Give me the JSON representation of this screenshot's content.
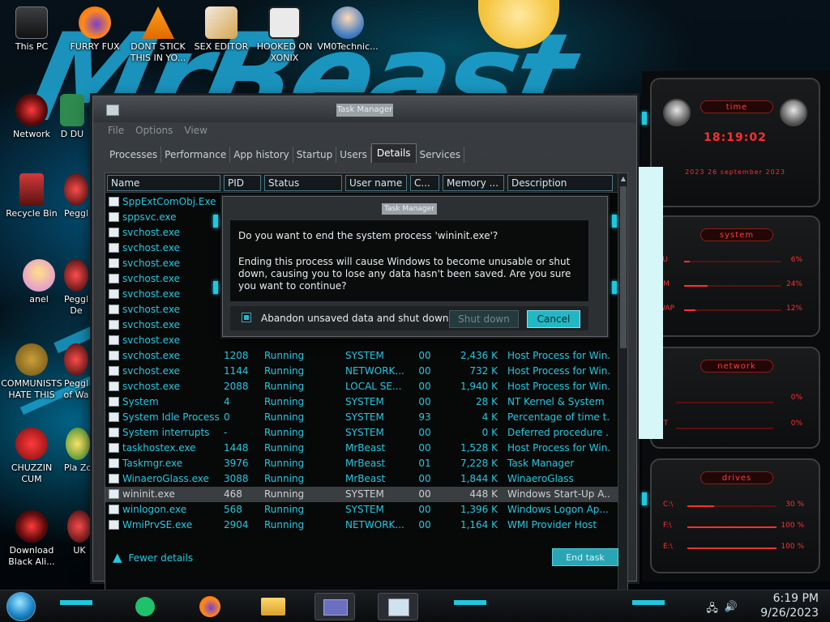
{
  "desktop": {
    "wallpaper_text": "MrBeast",
    "icons": [
      {
        "label": "This PC"
      },
      {
        "label": "FURRY FUX"
      },
      {
        "label": "DONT STICK THIS IN YO..."
      },
      {
        "label": "SEX EDITOR"
      },
      {
        "label": "HOOKED ON XONIX"
      },
      {
        "label": "VM0Technic..."
      },
      {
        "label": "Network"
      },
      {
        "label": "D DU"
      },
      {
        "label": "Recycle Bin"
      },
      {
        "label": "Peggl"
      },
      {
        "label": "anel"
      },
      {
        "label": "Peggl De"
      },
      {
        "label": "COMMUNISTS HATE THIS G..."
      },
      {
        "label": "Peggl of Wa"
      },
      {
        "label": "CHUZZIN CUM"
      },
      {
        "label": "Pla Zo"
      },
      {
        "label": "Download Black Ali..."
      },
      {
        "label": "UK"
      }
    ]
  },
  "taskmanager": {
    "title": "Task Manager",
    "menu": [
      "File",
      "Options",
      "View"
    ],
    "tabs": [
      "Processes",
      "Performance",
      "App history",
      "Startup",
      "Users",
      "Details",
      "Services"
    ],
    "active_tab": "Details",
    "columns": [
      "Name",
      "PID",
      "Status",
      "User name",
      "C...",
      "Memory ...",
      "Description"
    ],
    "rows": [
      {
        "name": "SppExtComObj.Exe",
        "pid": "",
        "status": "",
        "user": "",
        "cpu": "",
        "mem": "",
        "desc": ""
      },
      {
        "name": "sppsvc.exe",
        "pid": "",
        "status": "",
        "user": "",
        "cpu": "",
        "mem": "",
        "desc": ""
      },
      {
        "name": "svchost.exe",
        "pid": "",
        "status": "",
        "user": "",
        "cpu": "",
        "mem": "",
        "desc": ""
      },
      {
        "name": "svchost.exe",
        "pid": "",
        "status": "",
        "user": "",
        "cpu": "",
        "mem": "",
        "desc": ""
      },
      {
        "name": "svchost.exe",
        "pid": "",
        "status": "",
        "user": "",
        "cpu": "",
        "mem": "",
        "desc": ""
      },
      {
        "name": "svchost.exe",
        "pid": "",
        "status": "",
        "user": "",
        "cpu": "",
        "mem": "",
        "desc": ""
      },
      {
        "name": "svchost.exe",
        "pid": "",
        "status": "",
        "user": "",
        "cpu": "",
        "mem": "",
        "desc": ""
      },
      {
        "name": "svchost.exe",
        "pid": "",
        "status": "",
        "user": "",
        "cpu": "",
        "mem": "",
        "desc": ""
      },
      {
        "name": "svchost.exe",
        "pid": "",
        "status": "",
        "user": "",
        "cpu": "",
        "mem": "",
        "desc": ""
      },
      {
        "name": "svchost.exe",
        "pid": "",
        "status": "",
        "user": "",
        "cpu": "",
        "mem": "",
        "desc": ""
      },
      {
        "name": "svchost.exe",
        "pid": "1208",
        "status": "Running",
        "user": "SYSTEM",
        "cpu": "00",
        "mem": "2,436 K",
        "desc": "Host Process for Win..."
      },
      {
        "name": "svchost.exe",
        "pid": "1144",
        "status": "Running",
        "user": "NETWORK...",
        "cpu": "00",
        "mem": "732 K",
        "desc": "Host Process for Win..."
      },
      {
        "name": "svchost.exe",
        "pid": "2088",
        "status": "Running",
        "user": "LOCAL SE...",
        "cpu": "00",
        "mem": "1,940 K",
        "desc": "Host Process for Win..."
      },
      {
        "name": "System",
        "pid": "4",
        "status": "Running",
        "user": "SYSTEM",
        "cpu": "00",
        "mem": "28 K",
        "desc": "NT Kernel & System"
      },
      {
        "name": "System Idle Process",
        "pid": "0",
        "status": "Running",
        "user": "SYSTEM",
        "cpu": "93",
        "mem": "4 K",
        "desc": "Percentage of time t..."
      },
      {
        "name": "System interrupts",
        "pid": "-",
        "status": "Running",
        "user": "SYSTEM",
        "cpu": "00",
        "mem": "0 K",
        "desc": "Deferred procedure ..."
      },
      {
        "name": "taskhostex.exe",
        "pid": "1448",
        "status": "Running",
        "user": "MrBeast",
        "cpu": "00",
        "mem": "1,528 K",
        "desc": "Host Process for Win..."
      },
      {
        "name": "Taskmgr.exe",
        "pid": "3976",
        "status": "Running",
        "user": "MrBeast",
        "cpu": "01",
        "mem": "7,228 K",
        "desc": "Task Manager"
      },
      {
        "name": "WinaeroGlass.exe",
        "pid": "3088",
        "status": "Running",
        "user": "MrBeast",
        "cpu": "00",
        "mem": "1,844 K",
        "desc": "WinaeroGlass"
      },
      {
        "name": "wininit.exe",
        "pid": "468",
        "status": "Running",
        "user": "SYSTEM",
        "cpu": "00",
        "mem": "448 K",
        "desc": "Windows Start-Up A..."
      },
      {
        "name": "winlogon.exe",
        "pid": "568",
        "status": "Running",
        "user": "SYSTEM",
        "cpu": "00",
        "mem": "1,396 K",
        "desc": "Windows Logon Ap..."
      },
      {
        "name": "WmiPrvSE.exe",
        "pid": "2904",
        "status": "Running",
        "user": "NETWORK...",
        "cpu": "00",
        "mem": "1,164 K",
        "desc": "WMI Provider Host"
      }
    ],
    "selected_row": "wininit.exe",
    "fewer_details": "Fewer details",
    "end_task": "End task"
  },
  "dialog": {
    "title": "Task Manager",
    "question": "Do you want to end the system process 'wininit.exe'?",
    "warning": "Ending this process will cause Windows to become unusable or shut down, causing you to lose any data hasn't been saved. Are you sure you want to continue?",
    "checkbox_label": "Abandon unsaved data and shut down.",
    "checkbox_checked": true,
    "shutdown_label": "Shut down",
    "cancel_label": "Cancel"
  },
  "gadget": {
    "time_title": "time",
    "time": "18:19:02",
    "date": "2023 26 september 2023",
    "system_title": "system",
    "system_rows": [
      {
        "label": "PU",
        "value": "6%",
        "level": 0.06
      },
      {
        "label": "AM",
        "value": "24%",
        "level": 0.24
      },
      {
        "label": "WAP",
        "value": "12%",
        "level": 0.12
      }
    ],
    "network_title": "network",
    "network_rows": [
      {
        "label": "",
        "value": "0%"
      },
      {
        "label": "UT",
        "value": "0%"
      }
    ],
    "drives_title": "drives",
    "drives": [
      {
        "label": "C:\\",
        "value": "30 %",
        "level": 0.3
      },
      {
        "label": "F:\\",
        "value": "100 %",
        "level": 1.0
      },
      {
        "label": "E:\\",
        "value": "100 %",
        "level": 1.0
      }
    ],
    "accent_color": "#ff2e2e"
  },
  "taskbar": {
    "time": "6:19 PM",
    "date": "9/26/2023",
    "accent_color": "#1fc7df"
  }
}
